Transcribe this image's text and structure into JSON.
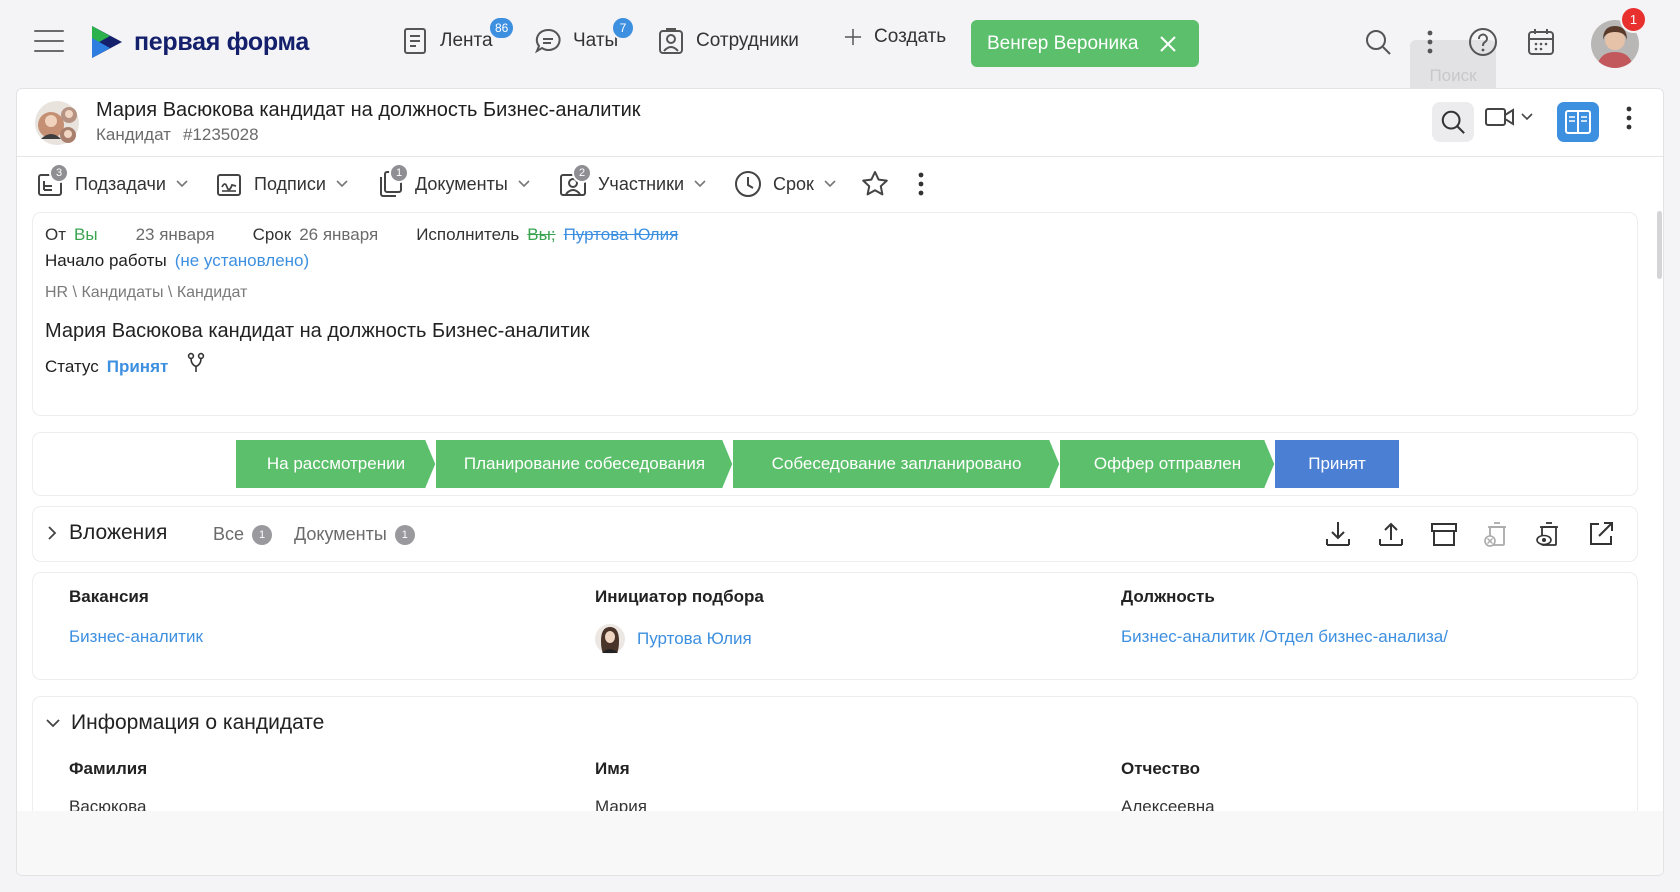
{
  "topbar": {
    "logo_text": "первая форма",
    "nav": [
      {
        "label": "Лента",
        "badge": "86",
        "icon": "feed-icon"
      },
      {
        "label": "Чаты",
        "badge": "7",
        "icon": "chat-icon"
      },
      {
        "label": "Сотрудники",
        "icon": "contacts-icon"
      },
      {
        "label": "Создать",
        "icon": "plus-icon"
      }
    ],
    "user_chip": "Венгер Вероника",
    "tooltip": "Поиск",
    "avatar_badge": "1"
  },
  "header": {
    "title": "Мария Васюкова кандидат на должность Бизнес-аналитик",
    "type": "Кандидат",
    "number": "#1235028"
  },
  "toolbar": {
    "items": [
      {
        "label": "Подзадачи",
        "badge": "3",
        "icon": "subtasks-icon"
      },
      {
        "label": "Подписи",
        "icon": "signature-icon"
      },
      {
        "label": "Документы",
        "badge": "1",
        "icon": "documents-icon"
      },
      {
        "label": "Участники",
        "badge": "2",
        "icon": "participants-icon"
      },
      {
        "label": "Срок",
        "icon": "clock-icon"
      }
    ]
  },
  "meta": {
    "from_label": "От",
    "from_value": "Вы",
    "created_date": "23 января",
    "deadline_label": "Срок",
    "deadline_value": "26 января",
    "executor_label": "Исполнитель",
    "executor_you": "Вы;",
    "executor_name": "Пуртова Юлия",
    "start_label": "Начало работы",
    "start_value": "(не установлено)",
    "path": "HR \\ Кандидаты \\ Кандидат",
    "description": "Мария Васюкова кандидат на должность Бизнес-аналитик",
    "status_label": "Статус",
    "status_value": "Принят"
  },
  "pipeline": {
    "stages": [
      {
        "label": "На рассмотрении",
        "state": "done"
      },
      {
        "label": "Планирование собеседования",
        "state": "done"
      },
      {
        "label": "Собеседование запланировано",
        "state": "done"
      },
      {
        "label": "Оффер отправлен",
        "state": "done"
      },
      {
        "label": "Принят",
        "state": "current"
      }
    ],
    "colors": {
      "done": "#5bbf6b",
      "current": "#4a7fd4"
    }
  },
  "attachments": {
    "title": "Вложения",
    "tab_all": "Все",
    "tab_all_count": "1",
    "tab_docs": "Документы",
    "tab_docs_count": "1"
  },
  "fields": {
    "vacancy_label": "Вакансия",
    "vacancy_value": "Бизнес-аналитик",
    "initiator_label": "Инициатор подбора",
    "initiator_value": "Пуртова Юлия",
    "position_label": "Должность",
    "position_value": "Бизнес-аналитик /Отдел бизнес-анализа/"
  },
  "candidate": {
    "title": "Информация о кандидате",
    "last_name_label": "Фамилия",
    "last_name_value": "Васюкова",
    "first_name_label": "Имя",
    "first_name_value": "Мария",
    "patronymic_label": "Отчество",
    "patronymic_value": "Алексеевна"
  }
}
